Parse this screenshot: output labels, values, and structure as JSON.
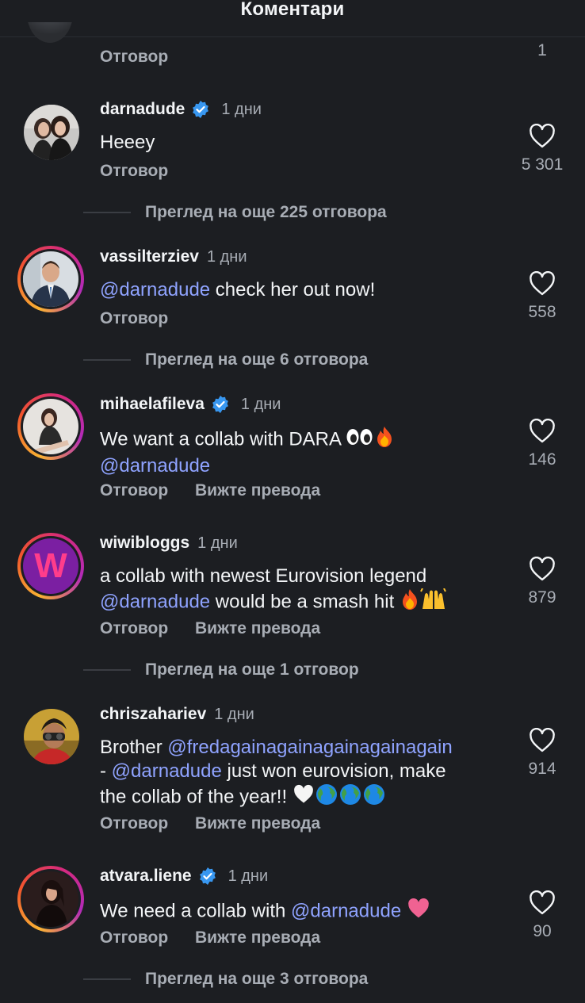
{
  "header": {
    "title": "Коментари"
  },
  "top_partial": {
    "reply_label": "Отговор",
    "count": "1"
  },
  "comments": [
    {
      "username": "darnadude",
      "verified": true,
      "time": "1 дни",
      "text": "Heeey",
      "reply_label": "Отговор",
      "likes": "5 301",
      "more_replies": "Преглед на още 225 отговора"
    },
    {
      "username": "vassilterziev",
      "verified": false,
      "time": "1 дни",
      "mention": "@darnadude",
      "text": " check her out now!",
      "reply_label": "Отговор",
      "likes": "558",
      "more_replies": "Преглед на още 6 отговора"
    },
    {
      "username": "mihaelafileva",
      "verified": true,
      "time": "1 дни",
      "text": "We want a collab with DARA ",
      "mention": "@darnadude",
      "reply_label": "Отговор",
      "translate_label": "Вижте превода",
      "likes": "146"
    },
    {
      "username": "wiwibloggs",
      "verified": false,
      "time": "1 дни",
      "text": "a collab with newest Eurovision legend",
      "mention": "@darnadude",
      "text2": " would be a smash hit ",
      "reply_label": "Отговор",
      "translate_label": "Вижте превода",
      "likes": "879",
      "more_replies": "Преглед на още 1 отговор",
      "avatar_letter": "W"
    },
    {
      "username": "chriszahariev",
      "verified": false,
      "time": "1 дни",
      "text": "Brother ",
      "mention": "@fredagainagainagainagainagain",
      "text2": "- ",
      "mention2": "@darnadude",
      "text3": " just won eurovision, make",
      "text4": "the collab of the year!! ",
      "reply_label": "Отговор",
      "translate_label": "Вижте превода",
      "likes": "914"
    },
    {
      "username": "atvara.liene",
      "verified": true,
      "time": "1 дни",
      "text": "We need a collab with ",
      "mention": "@darnadude",
      "reply_label": "Отговор",
      "translate_label": "Вижте превода",
      "likes": "90",
      "more_replies": "Преглед на още 3 отговора"
    }
  ],
  "colors": {
    "background": "#1c1e22",
    "mention": "#8fa3ff",
    "verified": "#3897f0",
    "secondary_text": "#a8adb5"
  },
  "icons": {
    "like": "heart-outline-icon",
    "verified": "verified-badge-icon"
  }
}
